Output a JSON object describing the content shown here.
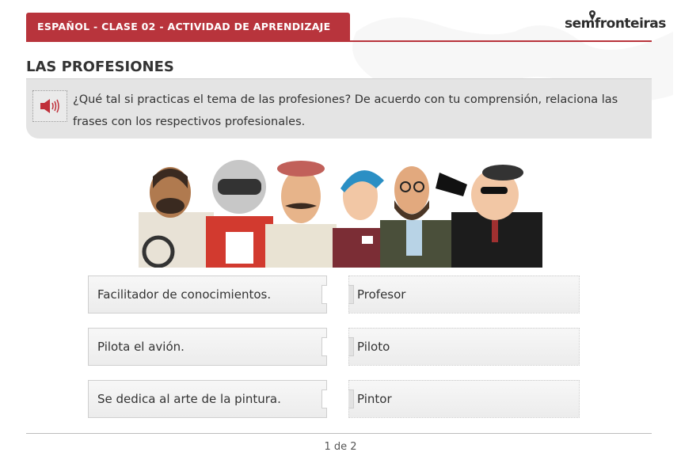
{
  "header": {
    "title": "ESPAÑOL - CLASE 02 - ACTIVIDAD DE APRENDIZAJE"
  },
  "logo": {
    "text": "semfronteiras"
  },
  "section": {
    "title": "LAS PROFESIONES"
  },
  "instruction": {
    "icon": "speaker-icon",
    "text": "¿Qué tal si practicas el tema de las profesiones? De acuerdo con tu comprensión, relaciona las frases con los respectivos profesionales."
  },
  "illustration": {
    "icon": "professions-characters-illustration"
  },
  "matching": {
    "phrases": [
      "Facilitador de conocimientos.",
      "Pilota el avión.",
      "Se dedica al arte de la pintura."
    ],
    "professions": [
      "Profesor",
      "Piloto",
      "Pintor"
    ]
  },
  "pagination": {
    "label": "1 de 2"
  },
  "colors": {
    "accent": "#b8343c",
    "panel": "#e4e4e4"
  }
}
